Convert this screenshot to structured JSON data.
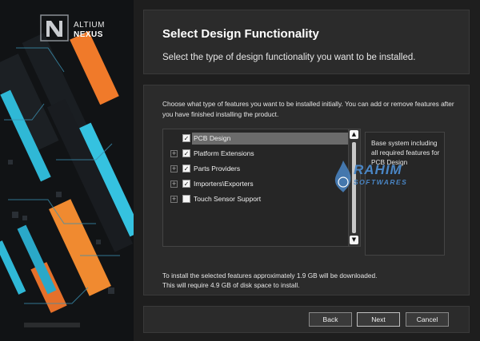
{
  "brand": {
    "line1": "ALTIUM",
    "line2": "NEXUS"
  },
  "header": {
    "title": "Select Design Functionality",
    "subtitle": "Select the type of design functionality you want to be installed."
  },
  "content": {
    "description": "Choose what type of features you want to be installed initially. You can add or remove features after you have finished installing the product.",
    "features": [
      {
        "label": "PCB Design",
        "checked": true,
        "expandable": false,
        "selected": true
      },
      {
        "label": "Platform Extensions",
        "checked": true,
        "expandable": true,
        "selected": false
      },
      {
        "label": "Parts Providers",
        "checked": true,
        "expandable": true,
        "selected": false
      },
      {
        "label": "Importers\\Exporters",
        "checked": true,
        "expandable": true,
        "selected": false
      },
      {
        "label": "Touch Sensor Support",
        "checked": false,
        "expandable": true,
        "selected": false
      }
    ],
    "info": "Base system including all required features for PCB Design",
    "install_note_line1": "To install the selected features approximately 1.9 GB will be downloaded.",
    "install_note_line2": "This will require 4.9 GB of disk space to install."
  },
  "watermark": {
    "title": "RAHIM",
    "subtitle": "SOFTWARES"
  },
  "footer": {
    "back_label": "Back",
    "next_label": "Next",
    "cancel_label": "Cancel"
  },
  "icons": {
    "expander": "plus-expander-icon",
    "check": "checkmark-icon",
    "scroll_up": "chevron-up-icon",
    "scroll_down": "chevron-down-icon"
  },
  "colors": {
    "background": "#1e1e1e",
    "panel": "#2b2b2b",
    "selection": "#6b6b6b",
    "accent_orange": "#f07a2a",
    "accent_cyan": "#2fb8d6",
    "watermark": "#4a86c5"
  }
}
